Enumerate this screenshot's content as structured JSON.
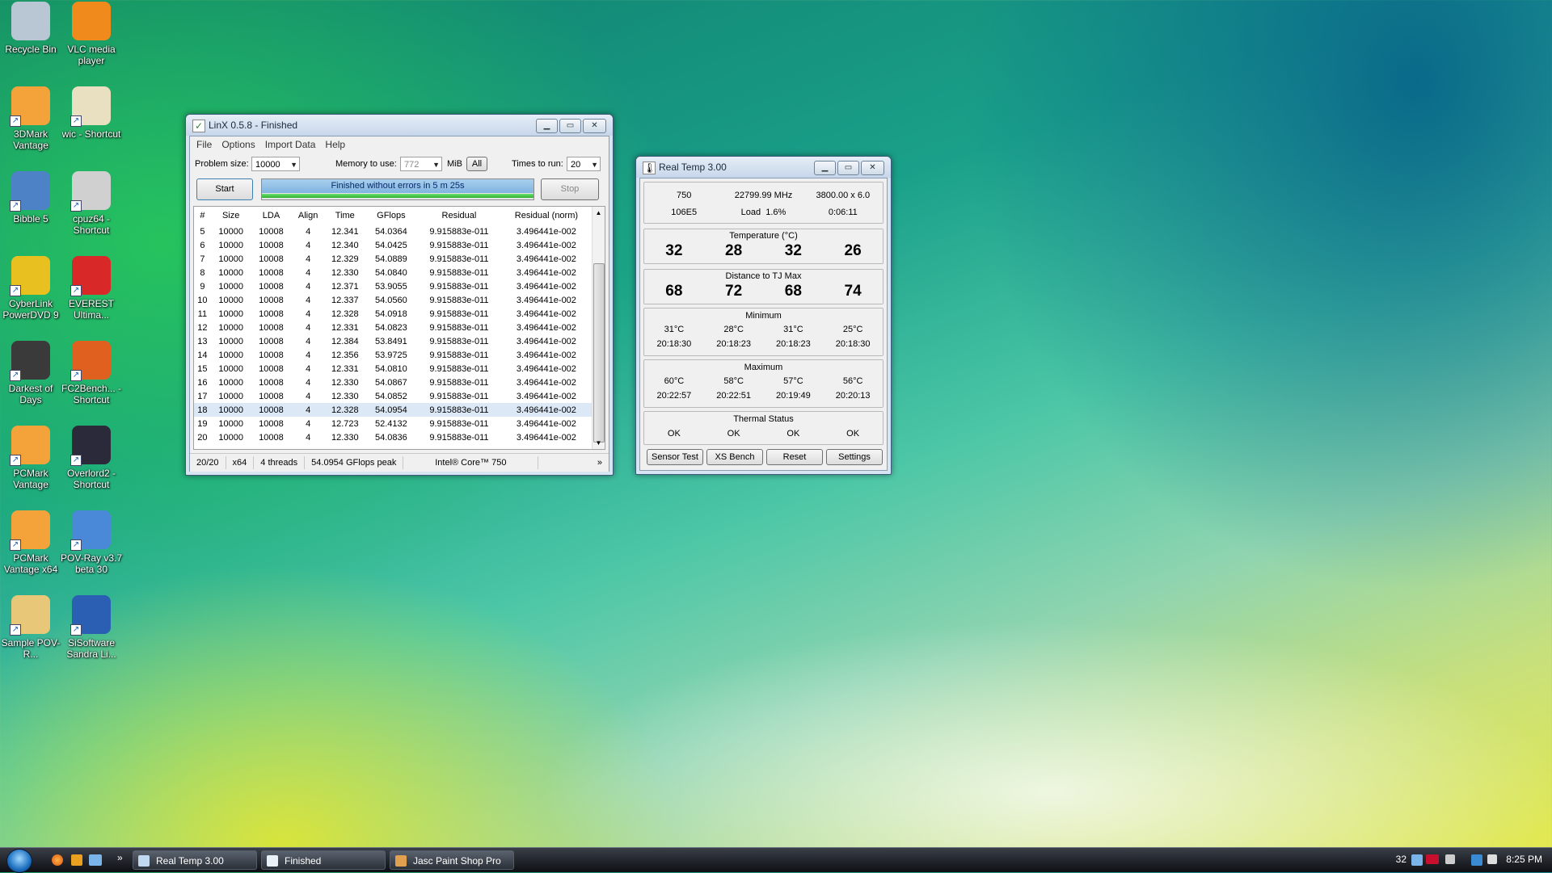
{
  "desktop": {
    "icons": [
      {
        "label": "Recycle Bin",
        "icon": "recycle-bin-icon"
      },
      {
        "label": "VLC media player",
        "icon": "vlc-icon"
      },
      {
        "label": "3DMark Vantage",
        "icon": "3dmark-icon"
      },
      {
        "label": "wic - Shortcut",
        "icon": "wic-icon"
      },
      {
        "label": "Bibble 5",
        "icon": "bibble-icon"
      },
      {
        "label": "cpuz64 - Shortcut",
        "icon": "cpuz-icon"
      },
      {
        "label": "CyberLink PowerDVD 9",
        "icon": "powerdvd-icon"
      },
      {
        "label": "EVEREST Ultima...",
        "icon": "everest-icon"
      },
      {
        "label": "Darkest of Days",
        "icon": "darkest-of-days-icon"
      },
      {
        "label": "FC2Bench... - Shortcut",
        "icon": "fc2bench-icon"
      },
      {
        "label": "PCMark Vantage",
        "icon": "pcmark-icon"
      },
      {
        "label": "Overlord2 - Shortcut",
        "icon": "overlord2-icon"
      },
      {
        "label": "PCMark Vantage x64",
        "icon": "pcmark-x64-icon"
      },
      {
        "label": "POV-Ray v3.7 beta 30",
        "icon": "povray-icon"
      },
      {
        "label": "Sample POV-R...",
        "icon": "folder-icon"
      },
      {
        "label": "SiSoftware Sandra Li...",
        "icon": "sandra-icon"
      }
    ]
  },
  "linx": {
    "title": "LinX 0.5.8 - Finished",
    "menu": [
      "File",
      "Options",
      "Import Data",
      "Help"
    ],
    "problem_size_label": "Problem size:",
    "problem_size": "10000",
    "memory_label": "Memory to use:",
    "memory_value": "772",
    "memory_unit": "MiB",
    "all_button": "All",
    "times_label": "Times to run:",
    "times_value": "20",
    "start_button": "Start",
    "stop_button": "Stop",
    "progress_text": "Finished without errors in 5 m 25s",
    "progress": 1.0,
    "columns": [
      "#",
      "Size",
      "LDA",
      "Align",
      "Time",
      "GFlops",
      "Residual",
      "Residual (norm)"
    ],
    "rows": [
      [
        "5",
        "10000",
        "10008",
        "4",
        "12.341",
        "54.0364",
        "9.915883e-011",
        "3.496441e-002"
      ],
      [
        "6",
        "10000",
        "10008",
        "4",
        "12.340",
        "54.0425",
        "9.915883e-011",
        "3.496441e-002"
      ],
      [
        "7",
        "10000",
        "10008",
        "4",
        "12.329",
        "54.0889",
        "9.915883e-011",
        "3.496441e-002"
      ],
      [
        "8",
        "10000",
        "10008",
        "4",
        "12.330",
        "54.0840",
        "9.915883e-011",
        "3.496441e-002"
      ],
      [
        "9",
        "10000",
        "10008",
        "4",
        "12.371",
        "53.9055",
        "9.915883e-011",
        "3.496441e-002"
      ],
      [
        "10",
        "10000",
        "10008",
        "4",
        "12.337",
        "54.0560",
        "9.915883e-011",
        "3.496441e-002"
      ],
      [
        "11",
        "10000",
        "10008",
        "4",
        "12.328",
        "54.0918",
        "9.915883e-011",
        "3.496441e-002"
      ],
      [
        "12",
        "10000",
        "10008",
        "4",
        "12.331",
        "54.0823",
        "9.915883e-011",
        "3.496441e-002"
      ],
      [
        "13",
        "10000",
        "10008",
        "4",
        "12.384",
        "53.8491",
        "9.915883e-011",
        "3.496441e-002"
      ],
      [
        "14",
        "10000",
        "10008",
        "4",
        "12.356",
        "53.9725",
        "9.915883e-011",
        "3.496441e-002"
      ],
      [
        "15",
        "10000",
        "10008",
        "4",
        "12.331",
        "54.0810",
        "9.915883e-011",
        "3.496441e-002"
      ],
      [
        "16",
        "10000",
        "10008",
        "4",
        "12.330",
        "54.0867",
        "9.915883e-011",
        "3.496441e-002"
      ],
      [
        "17",
        "10000",
        "10008",
        "4",
        "12.330",
        "54.0852",
        "9.915883e-011",
        "3.496441e-002"
      ],
      [
        "18",
        "10000",
        "10008",
        "4",
        "12.328",
        "54.0954",
        "9.915883e-011",
        "3.496441e-002"
      ],
      [
        "19",
        "10000",
        "10008",
        "4",
        "12.723",
        "52.4132",
        "9.915883e-011",
        "3.496441e-002"
      ],
      [
        "20",
        "10000",
        "10008",
        "4",
        "12.330",
        "54.0836",
        "9.915883e-011",
        "3.496441e-002"
      ]
    ],
    "selected_row": "18",
    "status": [
      "20/20",
      "x64",
      "4 threads",
      "54.0954 GFlops peak",
      "Intel® Core™ 750"
    ],
    "status_more": "»"
  },
  "realtemp": {
    "title": "Real Temp 3.00",
    "cpu": "750",
    "mhz": "22799.99 MHz",
    "multiplier": "3800.00 x 6.0",
    "cpuid": "106E5",
    "load_label": "Load",
    "load": "1.6%",
    "elapsed": "0:06:11",
    "temperature_label": "Temperature (°C)",
    "temperatures": [
      "32",
      "28",
      "32",
      "26"
    ],
    "distance_label": "Distance to TJ Max",
    "distances": [
      "68",
      "72",
      "68",
      "74"
    ],
    "minimum_label": "Minimum",
    "minimum_temps": [
      "31°C",
      "28°C",
      "31°C",
      "25°C"
    ],
    "minimum_times": [
      "20:18:30",
      "20:18:23",
      "20:18:23",
      "20:18:30"
    ],
    "maximum_label": "Maximum",
    "maximum_temps": [
      "60°C",
      "58°C",
      "57°C",
      "56°C"
    ],
    "maximum_times": [
      "20:22:57",
      "20:22:51",
      "20:19:49",
      "20:20:13"
    ],
    "thermal_label": "Thermal Status",
    "thermal": [
      "OK",
      "OK",
      "OK",
      "OK"
    ],
    "buttons": [
      "Sensor Test",
      "XS Bench",
      "Reset",
      "Settings"
    ]
  },
  "taskbar": {
    "items": [
      "Real Temp 3.00",
      "Finished",
      "Jasc Paint Shop Pro"
    ],
    "tray_temp": "32",
    "clock": "8:25 PM",
    "quicklaunch_more": "»"
  }
}
